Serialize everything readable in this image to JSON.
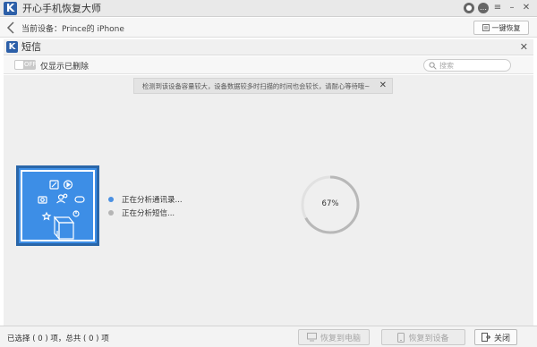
{
  "app": {
    "title": "开心手机恢复大师",
    "logo_letter": "K"
  },
  "device": {
    "label": "当前设备：Prince的 iPhone",
    "restore_button": "一键恢复"
  },
  "panel": {
    "title": "短信",
    "logo_letter": "K"
  },
  "filter": {
    "toggle_state": "OFF",
    "label": "仅显示已删除",
    "search_placeholder": "搜索"
  },
  "notice": {
    "text": "检测到该设备容量较大，设备数据较多时扫描的时间也会较长，请耐心等待哦~"
  },
  "status": {
    "items": [
      {
        "label": "正在分析通讯录...",
        "state": "active"
      },
      {
        "label": "正在分析短信...",
        "state": "pending"
      }
    ]
  },
  "progress": {
    "value": 0.67,
    "label": "67%"
  },
  "footer": {
    "selection": "已选择 ( 0 ) 项，总共 ( 0 ) 项",
    "restore_to_pc": "恢复到电脑",
    "restore_to_device": "恢复到设备",
    "close": "关闭"
  },
  "colors": {
    "accent": "#3d8ee6",
    "progress": "#b8b8b8",
    "active_dot": "#4a90e2"
  }
}
